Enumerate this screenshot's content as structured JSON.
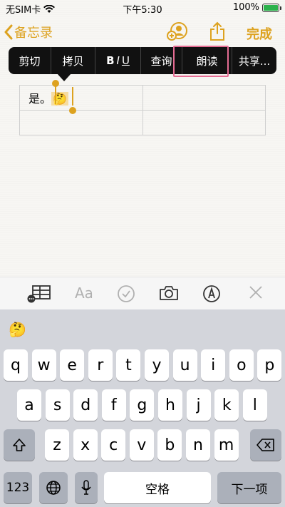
{
  "status_bar": {
    "carrier": "无SIM卡",
    "time": "下午5:30",
    "battery_pct": "100%"
  },
  "nav": {
    "back_label": "备忘录",
    "done_label": "完成",
    "share_icon": "share-icon",
    "collab_icon": "add-person-icon"
  },
  "edit_menu": {
    "items": [
      "剪切",
      "拷贝",
      "BIU",
      "查询",
      "朗读",
      "共享..."
    ],
    "highlighted": "朗读"
  },
  "note": {
    "cell_text": "是。",
    "cell_emoji": "🤔"
  },
  "toolbar": {
    "icons": [
      "table-icon",
      "format-icon",
      "checklist-icon",
      "camera-icon",
      "markup-icon",
      "close-icon"
    ]
  },
  "keyboard": {
    "suggestion": "🤔",
    "row1": [
      "q",
      "w",
      "e",
      "r",
      "t",
      "y",
      "u",
      "i",
      "o",
      "p"
    ],
    "row2": [
      "a",
      "s",
      "d",
      "f",
      "g",
      "h",
      "j",
      "k",
      "l"
    ],
    "row3": [
      "z",
      "x",
      "c",
      "v",
      "b",
      "n",
      "m"
    ],
    "numbers_label": "123",
    "space_label": "空格",
    "next_label": "下一项"
  },
  "colors": {
    "accent": "#dda21f",
    "highlight": "#e56c93"
  }
}
